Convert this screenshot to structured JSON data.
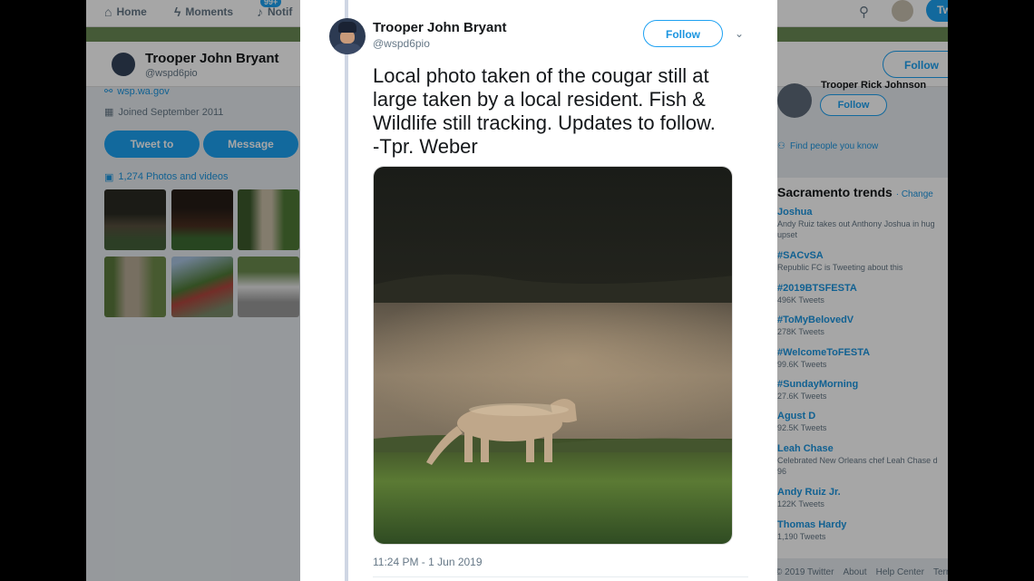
{
  "nav": {
    "home": "Home",
    "moments": "Moments",
    "notifications": "Notif",
    "badge": "99+",
    "tweet_label": "Tw"
  },
  "profile": {
    "name": "Trooper John Bryant",
    "handle": "@wspd6pio",
    "website": "wsp.wa.gov",
    "joined": "Joined September 2011",
    "tweet_to": "Tweet to",
    "message": "Message",
    "photos": "1,274 Photos and videos",
    "follow": "Follow"
  },
  "who_to_follow": {
    "name": "Trooper Rick Johnson",
    "follow": "Follow",
    "find_people": "Find people you know"
  },
  "trends": {
    "title": "Sacramento trends",
    "change": "· Change",
    "items": [
      {
        "name": "Joshua",
        "sub": "Andy Ruiz takes out Anthony Joshua in hug",
        "sub2": "upset"
      },
      {
        "name": "#SACvSA",
        "sub": "Republic FC is Tweeting about this",
        "sub2": ""
      },
      {
        "name": "#2019BTSFESTA",
        "sub": "496K Tweets",
        "sub2": ""
      },
      {
        "name": "#ToMyBelovedV",
        "sub": "278K Tweets",
        "sub2": ""
      },
      {
        "name": "#WelcomeToFESTA",
        "sub": "99.6K Tweets",
        "sub2": ""
      },
      {
        "name": "#SundayMorning",
        "sub": "27.6K Tweets",
        "sub2": ""
      },
      {
        "name": "Agust D",
        "sub": "92.5K Tweets",
        "sub2": ""
      },
      {
        "name": "Leah Chase",
        "sub": "Celebrated New Orleans chef Leah Chase d",
        "sub2": "96"
      },
      {
        "name": "Andy Ruiz Jr.",
        "sub": "122K Tweets",
        "sub2": ""
      },
      {
        "name": "Thomas Hardy",
        "sub": "1,190 Tweets",
        "sub2": ""
      }
    ]
  },
  "footer": {
    "copyright": "© 2019 Twitter",
    "about": "About",
    "help": "Help Center",
    "terms": "Terr"
  },
  "tweet": {
    "name": "Trooper John Bryant",
    "handle": "@wspd6pio",
    "follow": "Follow",
    "text": "Local photo taken of the cougar still at\nlarge taken by a local resident. Fish &\nWildlife still tracking.  Updates to follow.\n-Tpr. Weber",
    "timestamp": "11:24 PM - 1 Jun 2019"
  },
  "colors": {
    "accent": "#1da1f2",
    "link": "#1b95e0",
    "muted": "#657786"
  }
}
